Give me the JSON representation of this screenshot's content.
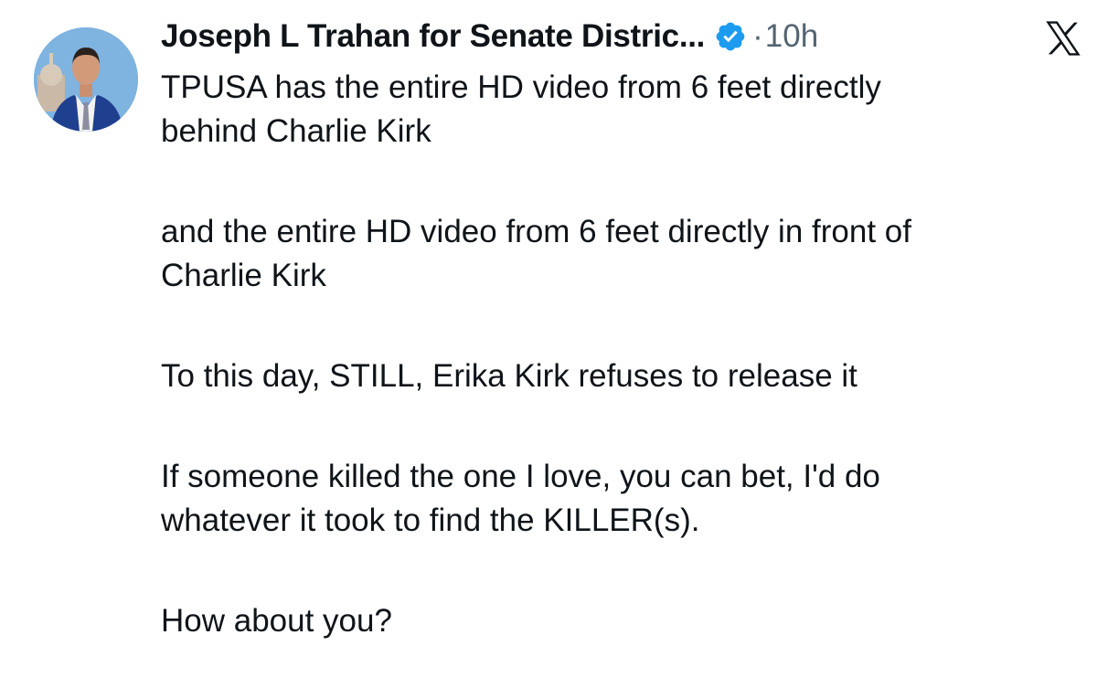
{
  "post": {
    "author_name": "Joseph L Trahan for Senate Distric...",
    "separator": "·",
    "timestamp": "10h",
    "verified_icon": "verified-badge-icon",
    "platform_icon": "x-logo-icon",
    "accent_color": "#1d9bf0",
    "paragraphs": [
      {
        "lines": [
          "TPUSA has the entire HD video from 6 feet directly",
          "behind Charlie Kirk"
        ]
      },
      {
        "lines": [
          "and the entire HD video from 6 feet directly in front of",
          "Charlie Kirk"
        ]
      },
      {
        "lines": [
          "To this day, STILL, Erika Kirk refuses to release it"
        ]
      },
      {
        "lines": [
          "If someone killed the one I love, you can bet, I'd do",
          "whatever it took to find the KILLER(s)."
        ]
      },
      {
        "lines": [
          "How about you?"
        ]
      }
    ]
  }
}
